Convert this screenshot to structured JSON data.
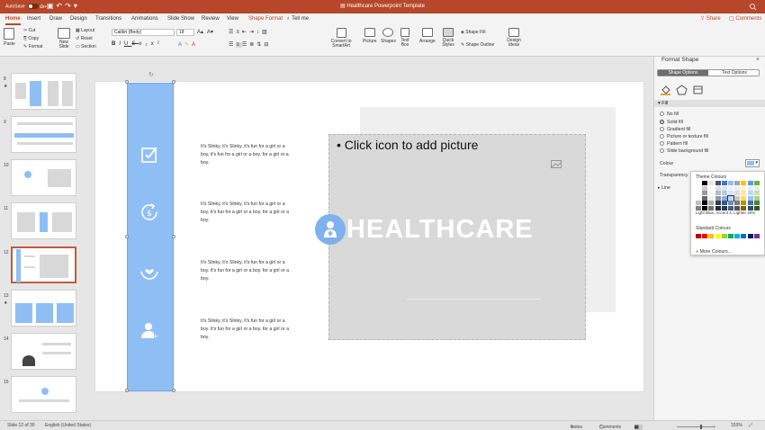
{
  "app": {
    "title": "Healthcare Powerpoint Template",
    "autosave_label": "AutoSave",
    "autosave_state": "OFF"
  },
  "tabs": [
    "Home",
    "Insert",
    "Draw",
    "Design",
    "Transitions",
    "Animations",
    "Slide Show",
    "Review",
    "View",
    "Shape Format",
    "Tell me"
  ],
  "header_actions": {
    "share": "Share",
    "comments": "Comments"
  },
  "ribbon": {
    "paste": "Paste",
    "cut": "Cut",
    "copy": "Copy",
    "format": "Format",
    "new_slide": "New Slide",
    "layout": "Layout",
    "reset": "Reset",
    "section": "Section",
    "font_name": "Calibri (Body)",
    "font_size": "18",
    "convert_smartart": "Convert to SmartArt",
    "picture": "Picture",
    "shapes": "Shapes",
    "text_box": "Text Box",
    "arrange": "Arrange",
    "quick_styles": "Quick Styles",
    "shape_fill": "Shape Fill",
    "shape_outline": "Shape Outline",
    "design_ideas": "Design Ideas"
  },
  "slides": [
    {
      "num": "8",
      "star": "★"
    },
    {
      "num": "9",
      "star": ""
    },
    {
      "num": "10",
      "star": ""
    },
    {
      "num": "11",
      "star": ""
    },
    {
      "num": "12",
      "star": ""
    },
    {
      "num": "13",
      "star": "★"
    },
    {
      "num": "14",
      "star": ""
    },
    {
      "num": "15",
      "star": ""
    }
  ],
  "slide_content": {
    "paragraphs": [
      "It's Slinky, it's Slinky, it's fun for a girl or a boy, it's fun for a girl or a boy. for a girl or a boy.",
      "It's Slinky, it's Slinky, it's fun for a girl or a boy. It's fun for a girl or a boy. for a girl or a boy.",
      "It's Slinky, it's Slinky, it's fun for a girl or a boy. It's fun for a girl or a boy. for a girl or a boy.",
      "It's Slinky, it's Slinky, it's fun for a girl or a boy. It's fun for a girl or a boy. for a girl or a boy."
    ],
    "placeholder_text": "• Click icon to add picture",
    "logo_text": "HEALTHCARE"
  },
  "format_pane": {
    "title": "Format Shape",
    "tab_shape": "Shape Options",
    "tab_text": "Text Options",
    "fill_section": "Fill",
    "fill_options": [
      "No fill",
      "Solid fill",
      "Gradient fill",
      "Picture or texture fill",
      "Pattern fill",
      "Slide background fill"
    ],
    "selected_fill": "Solid fill",
    "colour_label": "Colour",
    "transparency_label": "Transparency",
    "line_section": "Line"
  },
  "colour_picker": {
    "theme_header": "Theme Colours",
    "tooltip": "Light Blue, Accent 4, Lighter 40%",
    "standard_header": "Standard Colours",
    "more": "More Colours...",
    "standard_colors": [
      "#c00000",
      "#ff0000",
      "#ffc000",
      "#ffff00",
      "#92d050",
      "#00b050",
      "#00b0f0",
      "#0070c0",
      "#002060",
      "#7030a0"
    ]
  },
  "colors": {
    "accent": "#b7472a",
    "bar_blue": "#8fbef5",
    "logo_blue": "#7fb1ec"
  },
  "status": {
    "slide_info": "Slide 12 of 30",
    "language": "English (United States)",
    "notes": "Notes",
    "comments": "Comments",
    "zoom": "153%"
  }
}
